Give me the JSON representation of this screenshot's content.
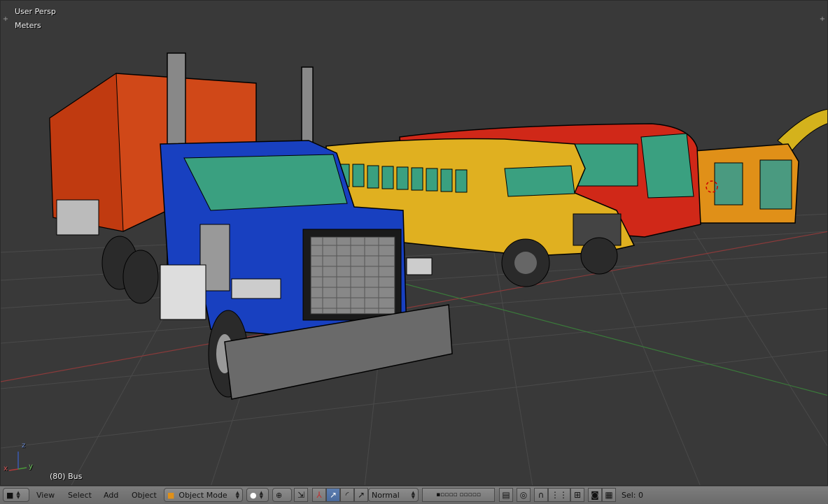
{
  "viewport": {
    "view_name": "User Persp",
    "units": "Meters",
    "object_info": "(80) Bus",
    "axis_labels": {
      "x": "x",
      "y": "y",
      "z": "z"
    }
  },
  "header": {
    "menus": [
      "View",
      "Select",
      "Add",
      "Object"
    ],
    "mode": "Object Mode",
    "orientation": "Normal",
    "selection_status": "Sel: 0"
  },
  "icons": {
    "editor_type": "cube-icon",
    "shading": "solid-sphere-icon",
    "pivot": "pivot-icon",
    "snap": "snap-magnet-icon",
    "render": "camera-icon"
  },
  "colors": {
    "viewport_bg": "#393939",
    "header_bg": "#727272",
    "active_button": "#5b7db0",
    "x_axis": "#b03a3a",
    "y_axis": "#4a9a3a",
    "z_axis": "#3a5ab0"
  }
}
